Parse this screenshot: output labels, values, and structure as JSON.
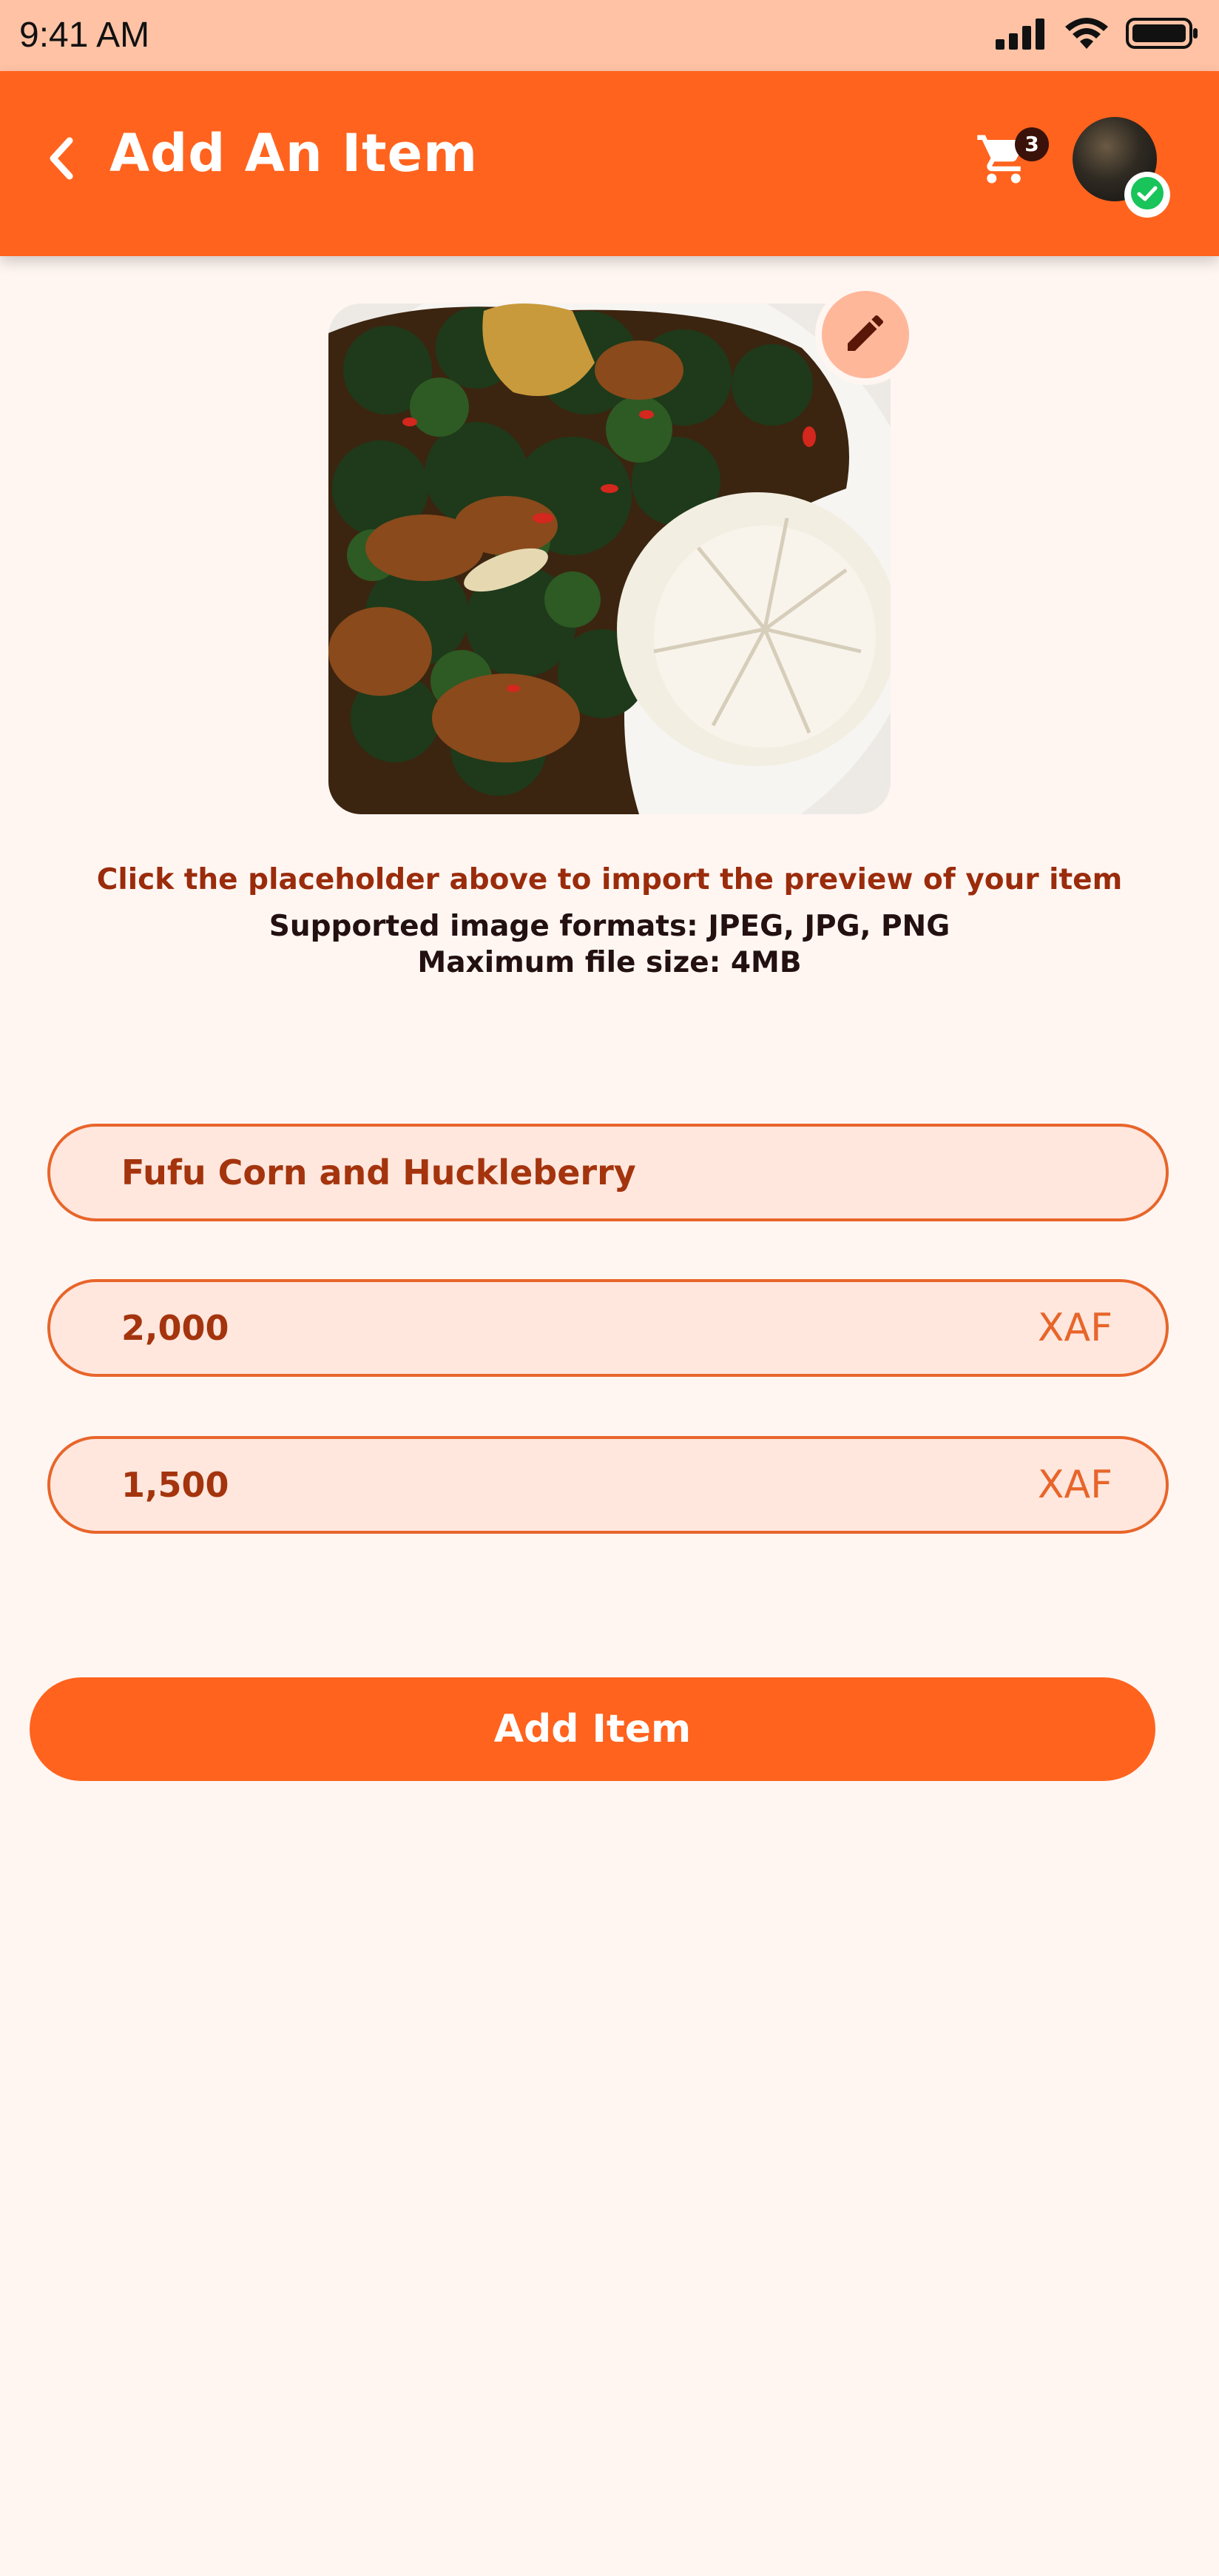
{
  "status_bar": {
    "time": "9:41 AM"
  },
  "header": {
    "title": "Add An Item",
    "cart_count": "3",
    "colors": {
      "background": "#FF631E",
      "badge": "#3A120A"
    }
  },
  "upload": {
    "instruction": "Click the placeholder above to import the preview of your item",
    "formats": "Supported image formats: JPEG, JPG, PNG",
    "max_size": "Maximum file size: 4MB"
  },
  "form": {
    "name_value": "Fufu Corn and Huckleberry",
    "price_value": "2,000",
    "price_currency": "XAF",
    "discount_value": "1,500",
    "discount_currency": "XAF"
  },
  "actions": {
    "add_item_label": "Add Item"
  },
  "icons": {
    "back": "chevron-left-icon",
    "cart": "cart-icon",
    "edit": "pencil-icon",
    "verified": "check-circle-icon"
  }
}
